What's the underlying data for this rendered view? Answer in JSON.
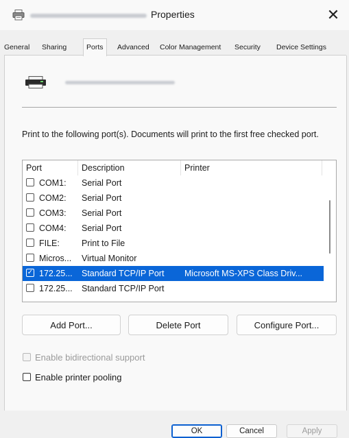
{
  "window": {
    "title": "Properties",
    "close_symbol": "✕",
    "printer_name_blurred": true
  },
  "tabs": [
    {
      "label": "General"
    },
    {
      "label": "Sharing"
    },
    {
      "label": "Ports",
      "active": true
    },
    {
      "label": "Advanced"
    },
    {
      "label": "Color Management"
    },
    {
      "label": "Security"
    },
    {
      "label": "Device Settings"
    }
  ],
  "ports_tab": {
    "instructions": "Print to the following port(s). Documents will print to the first free checked port.",
    "columns": {
      "port": "Port",
      "description": "Description",
      "printer": "Printer"
    },
    "rows": [
      {
        "port": "COM1:",
        "description": "Serial Port",
        "printer": "",
        "checked": false,
        "selected": false
      },
      {
        "port": "COM2:",
        "description": "Serial Port",
        "printer": "",
        "checked": false,
        "selected": false
      },
      {
        "port": "COM3:",
        "description": "Serial Port",
        "printer": "",
        "checked": false,
        "selected": false
      },
      {
        "port": "COM4:",
        "description": "Serial Port",
        "printer": "",
        "checked": false,
        "selected": false
      },
      {
        "port": "FILE:",
        "description": "Print to File",
        "printer": "",
        "checked": false,
        "selected": false
      },
      {
        "port": "Micros...",
        "description": "Virtual Monitor",
        "printer": "",
        "checked": false,
        "selected": false
      },
      {
        "port": "172.25...",
        "description": "Standard TCP/IP Port",
        "printer": "Microsoft MS-XPS Class Driv...",
        "checked": true,
        "selected": true
      },
      {
        "port": "172.25...",
        "description": "Standard TCP/IP Port",
        "printer": "",
        "checked": false,
        "selected": false
      }
    ],
    "buttons": {
      "add": "Add Port...",
      "delete": "Delete Port",
      "configure": "Configure Port..."
    },
    "options": {
      "bidirectional": {
        "label": "Enable bidirectional support",
        "checked": false,
        "enabled": false
      },
      "pooling": {
        "label": "Enable printer pooling",
        "checked": false,
        "enabled": true
      }
    }
  },
  "footer": {
    "ok": "OK",
    "cancel": "Cancel",
    "apply": "Apply"
  },
  "colors": {
    "selection": "#0a66d8",
    "accent_border": "#0a5fd0"
  }
}
